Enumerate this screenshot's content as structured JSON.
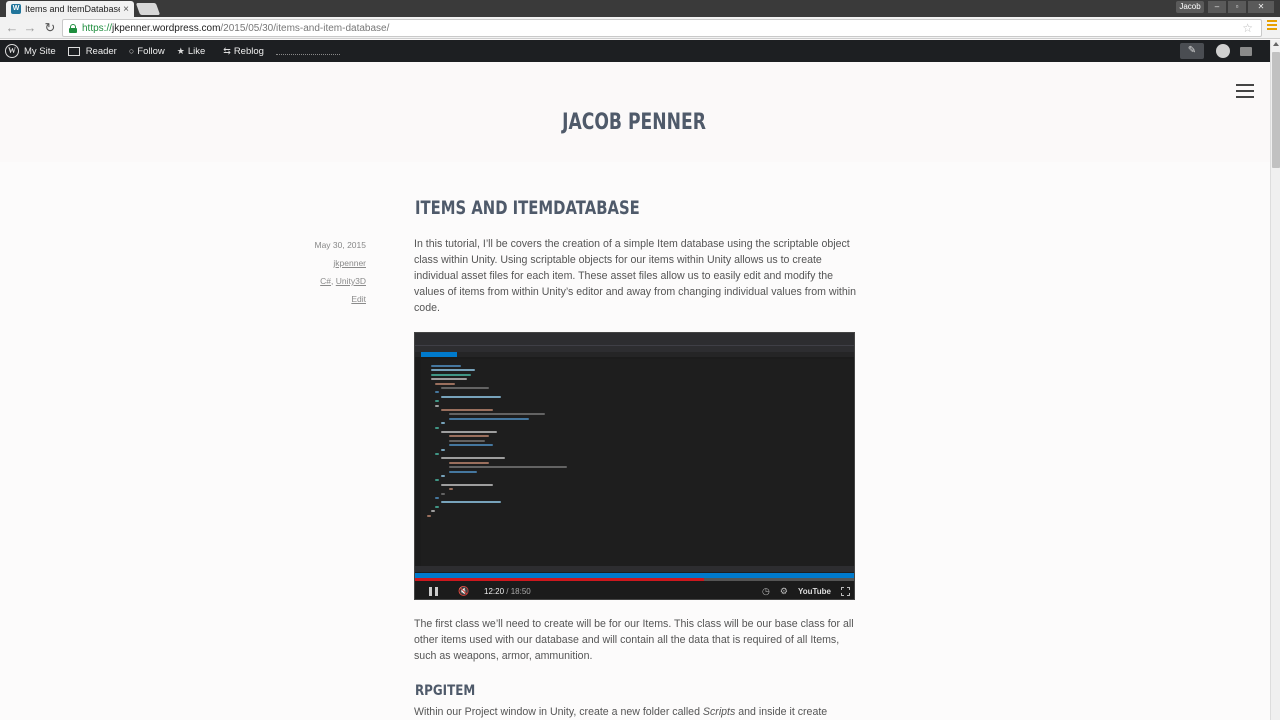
{
  "browser": {
    "tab_title": "Items and ItemDatabase |",
    "tab_close": "×",
    "favicon": "W",
    "user_badge": "Jacob",
    "win_min": "–",
    "win_restore": "▫",
    "win_close": "✕",
    "url_scheme": "https://",
    "url_host": "jkpenner.wordpress.com",
    "url_path": "/2015/05/30/items-and-item-database/",
    "back": "←",
    "forward": "→",
    "reload": "↻",
    "star": "☆"
  },
  "wpbar": {
    "wp_logo": "W",
    "my_site": "My Site",
    "reader": "Reader",
    "follow_icon": "○",
    "follow": "Follow",
    "like_icon": "★",
    "like": "Like",
    "reblog_icon": "⇆",
    "reblog": "Reblog",
    "write_icon": "✎"
  },
  "site": {
    "title": "JACOB PENNER"
  },
  "post": {
    "title": "ITEMS AND ITEMDATABASE",
    "meta": {
      "date": "May 30, 2015",
      "author": "jkpenner",
      "cat1": "C#",
      "cat_sep": ", ",
      "cat2": "Unity3D",
      "edit": "Edit"
    },
    "para1": "In this tutorial, I’ll be covers the creation of a simple Item database using the scriptable object class within Unity. Using scriptable objects for our items within Unity allows us to create individual asset files for each item. These asset files allow us to easily edit and modify the values of items from within Unity’s editor and away from changing individual values from within code.",
    "para2": "The first class we’ll need to create will be for our Items. This class will be our base class for all other items used with our database and will contain all the data that is required of all Items, such as weapons, armor, ammunition.",
    "section_heading": "RPGITEM",
    "para3_start": "Within our Project window in Unity, create a new folder called ",
    "para3_italic": "Scripts",
    "para3_end": " and inside it create"
  },
  "video": {
    "current_time": "12:20",
    "separator": " / ",
    "duration": "18:50",
    "progress_fraction": 0.655,
    "mute_icon": "🔇",
    "clock_icon": "◷",
    "gear_icon": "⚙",
    "youtube_logo": "YouTube"
  },
  "colors": {
    "site_title": "#4f5a6a",
    "admin_bar": "#1d1f22",
    "vs_accent": "#007acc",
    "yt_red": "#cc181e"
  }
}
